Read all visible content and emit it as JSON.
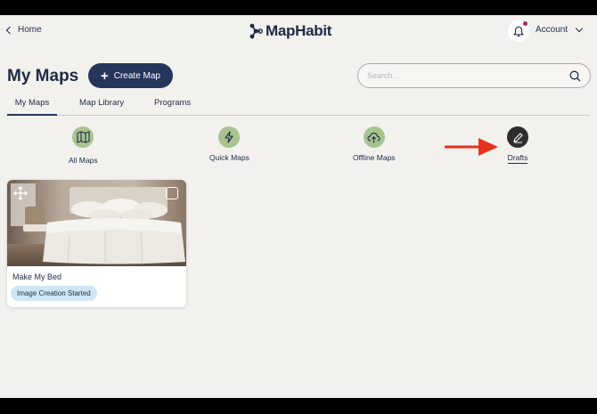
{
  "header": {
    "back_label": "Home",
    "logo_text": "MapHabit",
    "account_label": "Account"
  },
  "page": {
    "title": "My Maps",
    "create_label": "Create Map",
    "search_placeholder": "Search..."
  },
  "tabs": [
    {
      "label": "My Maps",
      "active": true
    },
    {
      "label": "Map Library",
      "active": false
    },
    {
      "label": "Programs",
      "active": false
    }
  ],
  "categories": [
    {
      "label": "All Maps",
      "icon": "map-icon"
    },
    {
      "label": "Quick Maps",
      "icon": "lightning-icon"
    },
    {
      "label": "Offline Maps",
      "icon": "cloud-download-icon"
    },
    {
      "label": "Drafts",
      "icon": "pencil-icon",
      "selected": true
    }
  ],
  "cards": [
    {
      "title": "Make My Bed",
      "status": "Image Creation Started"
    }
  ],
  "colors": {
    "background": "#f2f1ee",
    "primary": "#25355b",
    "category_green": "#a7c48e",
    "badge_blue": "#cfe7f5",
    "annotation_arrow": "#e8321e",
    "notification_dot": "#b0236b"
  }
}
